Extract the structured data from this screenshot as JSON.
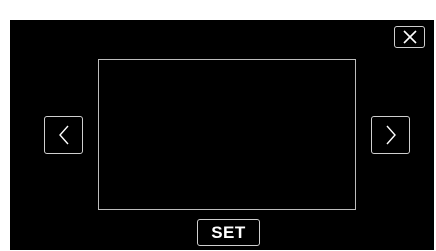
{
  "controls": {
    "close": {
      "icon": "close-icon"
    },
    "prev": {
      "icon": "chevron-left-icon"
    },
    "next": {
      "icon": "chevron-right-icon"
    },
    "set_label": "SET"
  },
  "colors": {
    "background": "#000000",
    "border": "#cfcfcf",
    "text": "#ffffff"
  }
}
